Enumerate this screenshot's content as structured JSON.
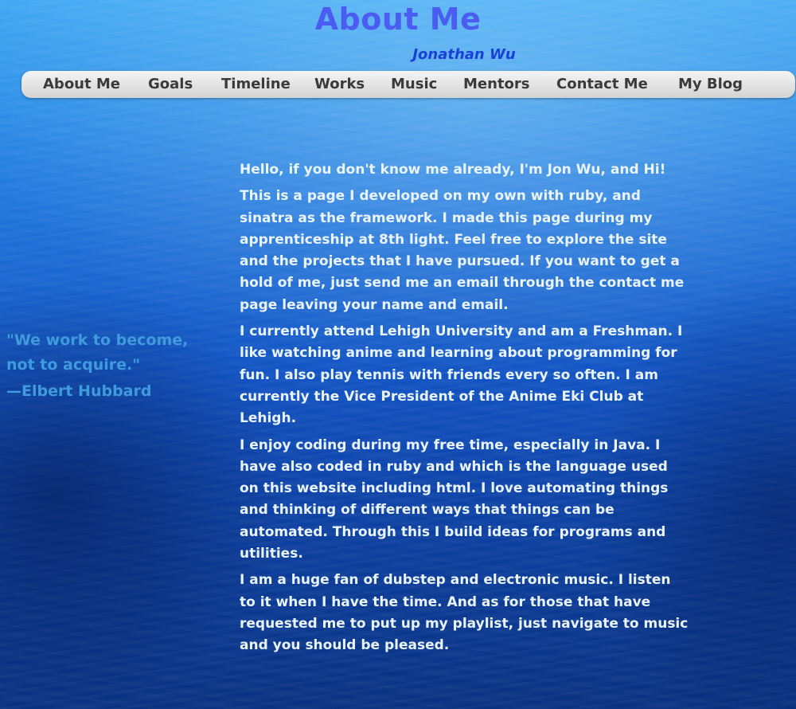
{
  "header": {
    "title": "About Me",
    "subtitle": "Jonathan Wu"
  },
  "nav": {
    "items": [
      {
        "label": "About Me"
      },
      {
        "label": "Goals"
      },
      {
        "label": "Timeline"
      },
      {
        "label": "Works"
      },
      {
        "label": "Music"
      },
      {
        "label": "Mentors"
      },
      {
        "label": "Contact Me"
      },
      {
        "label": "My Blog"
      }
    ]
  },
  "sidebar": {
    "quote": "\"We work to become, not to acquire.\"",
    "author": "—Elbert Hubbard"
  },
  "main": {
    "paragraphs": [
      "Hello, if you don't know me already, I'm Jon Wu, and Hi!",
      "This is a page I developed on my own with ruby, and sinatra as the framework. I made this page during my apprenticeship at 8th light. Feel free to explore the site and the projects that I have pursued. If you want to get a hold of me, just send me an email through the contact me page leaving your name and email.",
      "I currently attend Lehigh University and am a Freshman. I like watching anime and learning about programming for fun. I also play tennis with friends every so often. I am currently the Vice President of the Anime Eki Club at Lehigh.",
      "I enjoy coding during my free time, especially in Java. I have also coded in ruby and which is the language used on this website including html. I love automating things and thinking of different ways that things can be automated. Through this I build ideas for programs and utilities.",
      "I am a huge fan of dubstep and electronic music. I listen to it when I have the time. And as for those that have requested me to put up my playlist, just navigate to music and you should be pleased."
    ]
  },
  "colors": {
    "title": "#4b5cf0",
    "subtitle": "#1a40d6",
    "quote": "#3e9bdc",
    "body_text": "#e9f4ff",
    "nav_bg": "#e2e2e2",
    "nav_text": "#3a3a3a"
  }
}
